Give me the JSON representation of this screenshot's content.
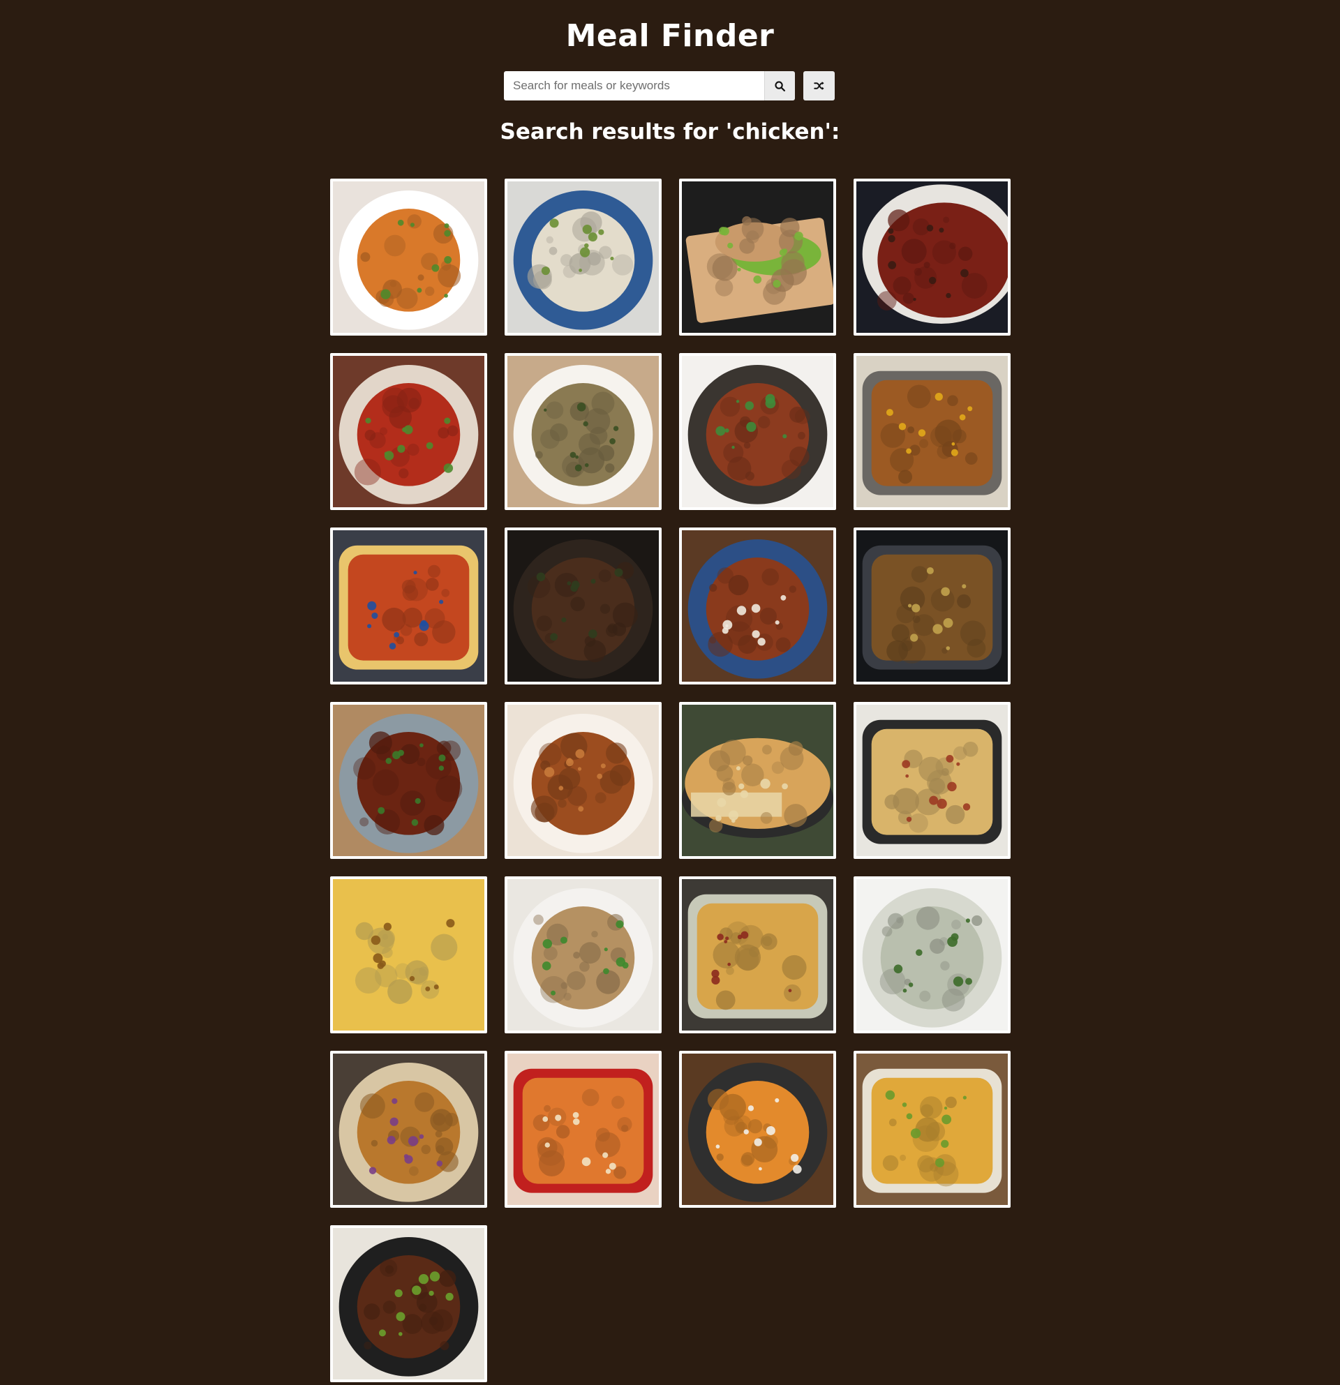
{
  "header": {
    "title": "Meal Finder"
  },
  "search": {
    "placeholder": "Search for meals or keywords",
    "value": ""
  },
  "results": {
    "heading": "Search results for 'chicken':"
  },
  "meals": [
    {
      "kind": "bowl",
      "bg": "#e9e2dc",
      "plate": "#ffffff",
      "food": "#d9792a",
      "accent": "#4f8a2b"
    },
    {
      "kind": "bowl",
      "bg": "#d9d9d6",
      "plate": "#2f5b95",
      "food": "#e3dccb",
      "accent": "#6a8f34"
    },
    {
      "kind": "board",
      "bg": "#1d1d1d",
      "plate": "#d9ae7f",
      "food": "#c99a6a",
      "accent": "#79b43a"
    },
    {
      "kind": "pot",
      "bg": "#1a1c25",
      "plate": "#e7e4df",
      "food": "#7a2016",
      "accent": "#3a1b12"
    },
    {
      "kind": "plate",
      "bg": "#6e3a2a",
      "plate": "#e2d6c9",
      "food": "#b32d1b",
      "accent": "#4e8a2e"
    },
    {
      "kind": "bowl",
      "bg": "#c7aa8a",
      "plate": "#f6f3ee",
      "food": "#8a7a52",
      "accent": "#3a4f22"
    },
    {
      "kind": "bowl",
      "bg": "#f3f1ee",
      "plate": "#3a3530",
      "food": "#8c3b1f",
      "accent": "#3f8c3a"
    },
    {
      "kind": "pan",
      "bg": "#d9d2c4",
      "plate": "#6a6763",
      "food": "#9c5a23",
      "accent": "#e2a81a"
    },
    {
      "kind": "dish",
      "bg": "#3a3e48",
      "plate": "#e9c56c",
      "food": "#c4471f",
      "accent": "#1f4fa0"
    },
    {
      "kind": "bowl",
      "bg": "#1b1714",
      "plate": "#2e241d",
      "food": "#4a2d1c",
      "accent": "#2f3d1e"
    },
    {
      "kind": "bowl",
      "bg": "#5b3a24",
      "plate": "#2c4f86",
      "food": "#8a3a1c",
      "accent": "#efe9dd"
    },
    {
      "kind": "pan",
      "bg": "#141619",
      "plate": "#3a3d44",
      "food": "#7a5225",
      "accent": "#c1a24c"
    },
    {
      "kind": "bowl",
      "bg": "#b08a62",
      "plate": "#8c9aa3",
      "food": "#6b2412",
      "accent": "#3b7a2a"
    },
    {
      "kind": "plate",
      "bg": "#ece2d6",
      "plate": "#f7f1ea",
      "food": "#9c4d1f",
      "accent": "#c87a3a"
    },
    {
      "kind": "pie",
      "bg": "#3f4a35",
      "plate": "#2b2b2b",
      "food": "#d8a45a",
      "accent": "#e9d7a8"
    },
    {
      "kind": "pan",
      "bg": "#e8e6e0",
      "plate": "#2a2a2a",
      "food": "#d9b46a",
      "accent": "#9c3a22"
    },
    {
      "kind": "gratin",
      "bg": "#b98a2a",
      "plate": "#e9c04c",
      "food": "#f0d06a",
      "accent": "#8a5a1a"
    },
    {
      "kind": "bowl",
      "bg": "#eae7e1",
      "plate": "#f4f2ef",
      "food": "#b59162",
      "accent": "#3e8a2d"
    },
    {
      "kind": "dish",
      "bg": "#3d3a35",
      "plate": "#c7c9b8",
      "food": "#d8a54a",
      "accent": "#8c2a1e"
    },
    {
      "kind": "plate",
      "bg": "#f3f3f1",
      "plate": "#d7d9cf",
      "food": "#b9bfae",
      "accent": "#3d6b2a"
    },
    {
      "kind": "plate",
      "bg": "#4a3f36",
      "plate": "#d8c6a4",
      "food": "#b9782d",
      "accent": "#7a3e86"
    },
    {
      "kind": "dish",
      "bg": "#e9d2c2",
      "plate": "#c1201e",
      "food": "#e0782e",
      "accent": "#f2e2c2"
    },
    {
      "kind": "bowl",
      "bg": "#5a3a22",
      "plate": "#2f2f2f",
      "food": "#e38a2c",
      "accent": "#f2eee8"
    },
    {
      "kind": "dish",
      "bg": "#7a5a3c",
      "plate": "#e7e1d3",
      "food": "#e0a83a",
      "accent": "#6a9a2c"
    },
    {
      "kind": "plate",
      "bg": "#e8e4dc",
      "plate": "#1f1f1f",
      "food": "#5a2a16",
      "accent": "#6aa02c"
    }
  ]
}
